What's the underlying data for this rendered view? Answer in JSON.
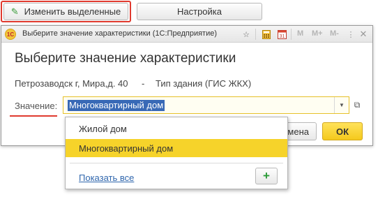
{
  "toolbar": {
    "edit_selected_label": "Изменить выделенные",
    "settings_label": "Настройка",
    "edit_icon": "pencil-icon"
  },
  "window": {
    "title": "Выберите значение характеристики  (1С:Предприятие)",
    "logo_text": "1С",
    "title_icons": [
      "star-icon",
      "calculator-icon",
      "calendar-icon"
    ],
    "memory_labels": [
      "M",
      "M+",
      "M-"
    ],
    "heading": "Выберите значение характеристики",
    "address": "Петрозаводск г, Мира,д. 40",
    "dash": "-",
    "characteristic": "Тип здания (ГИС ЖКХ)",
    "field_label": "Значение:",
    "field_value": "Многоквартирный дом",
    "cancel_label": "Отмена",
    "ok_label": "ОК"
  },
  "dropdown": {
    "options": [
      "Жилой дом",
      "Многоквартирный дом"
    ],
    "selected_index": 1,
    "show_all_label": "Показать все",
    "add_label": "+"
  },
  "colors": {
    "accent_yellow": "#f6d32a",
    "highlight_blue": "#3869b6",
    "annotation_red": "#e03a2f",
    "link_blue": "#2f66ad",
    "add_green": "#2a9b37"
  }
}
